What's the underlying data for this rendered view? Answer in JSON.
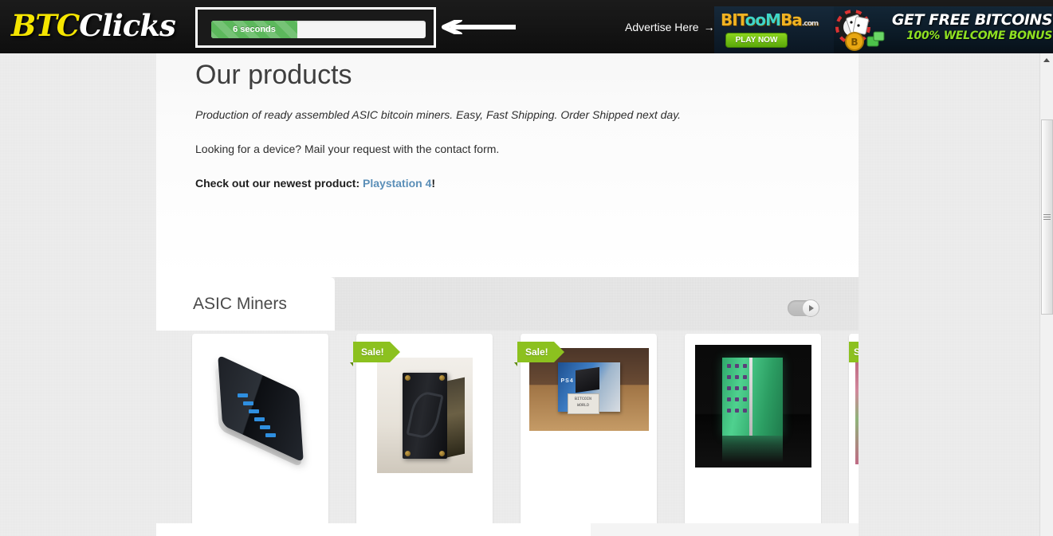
{
  "header": {
    "logo": {
      "part1": "BTC",
      "part2": "Clicks"
    },
    "progress": {
      "label": "6 seconds",
      "percent": 40,
      "fill_color": "#5cb85c",
      "track_color": "#f5f5f5"
    },
    "pointer_icon": "left-arrow-icon",
    "advertise": {
      "label": "Advertise Here",
      "arrow": "→"
    },
    "banner_ad": {
      "brand_bit": "BIT",
      "brand_oom": "ooM",
      "brand_ba": "Ba",
      "brand_dotcom": ".com",
      "play_now": "PLAY NOW",
      "headline": "GET FREE BITCOINS",
      "subline": "100% WELCOME BONUS",
      "accent_gold": "#f0b323",
      "accent_green": "#8fe021"
    }
  },
  "main": {
    "title": "Our products",
    "intro_italic": "Production of ready assembled ASIC bitcoin miners. Easy, Fast Shipping. Order Shipped next day.",
    "intro_plain": "Looking for a device? Mail your request with the contact form.",
    "newest_prefix": "Check out our newest product:",
    "newest_link": "Playstation 4",
    "newest_suffix": "!",
    "link_color": "#5b8fb8"
  },
  "products_section": {
    "tab_label": "ASIC Miners",
    "toggle_icon": "play-toggle-icon",
    "sale_badge": "Sale!",
    "sale_color": "#8cc11f",
    "cards": [
      {
        "name": "usb-hub",
        "sale": false
      },
      {
        "name": "acrylic-miner-case",
        "sale": true
      },
      {
        "name": "playstation-4-box",
        "sale": true
      },
      {
        "name": "pcb-hash-board",
        "sale": false
      },
      {
        "name": "partial-product",
        "sale": true
      }
    ],
    "ps4_sign_text": "BITCOIN WORLD"
  },
  "scrollbar": {
    "up_icon": "scroll-up-arrow-icon",
    "thumb_grip_icon": "scrollbar-grip-icon"
  }
}
